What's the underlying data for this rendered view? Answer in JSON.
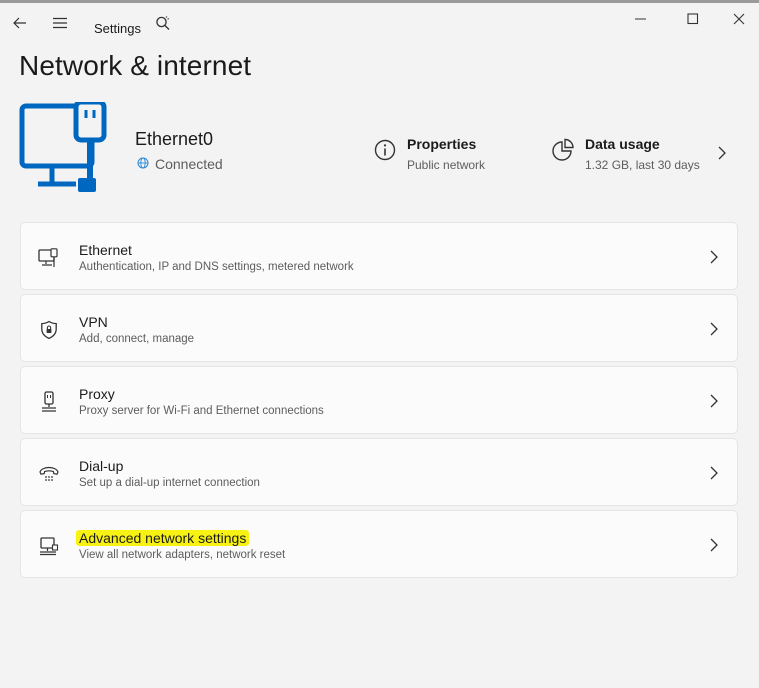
{
  "window": {
    "app_title": "Settings",
    "back_icon": "arrow-left-icon",
    "menu_icon": "hamburger-menu-icon",
    "search_icon": "search-icon"
  },
  "page": {
    "title": "Network & internet"
  },
  "connection": {
    "name": "Ethernet0",
    "status": "Connected",
    "accent": "#0067c0",
    "properties": {
      "title": "Properties",
      "subtitle": "Public network"
    },
    "data_usage": {
      "title": "Data usage",
      "subtitle": "1.32 GB, last 30 days"
    }
  },
  "cards": [
    {
      "title": "Ethernet",
      "subtitle": "Authentication, IP and DNS settings, metered network",
      "icon": "ethernet-icon"
    },
    {
      "title": "VPN",
      "subtitle": "Add, connect, manage",
      "icon": "shield-icon"
    },
    {
      "title": "Proxy",
      "subtitle": "Proxy server for Wi-Fi and Ethernet connections",
      "icon": "proxy-icon"
    },
    {
      "title": "Dial-up",
      "subtitle": "Set up a dial-up internet connection",
      "icon": "dialup-phone-icon"
    },
    {
      "title": "Advanced network settings",
      "subtitle": "View all network adapters, network reset",
      "icon": "network-adapter-icon",
      "highlight": "#f7f214"
    }
  ]
}
